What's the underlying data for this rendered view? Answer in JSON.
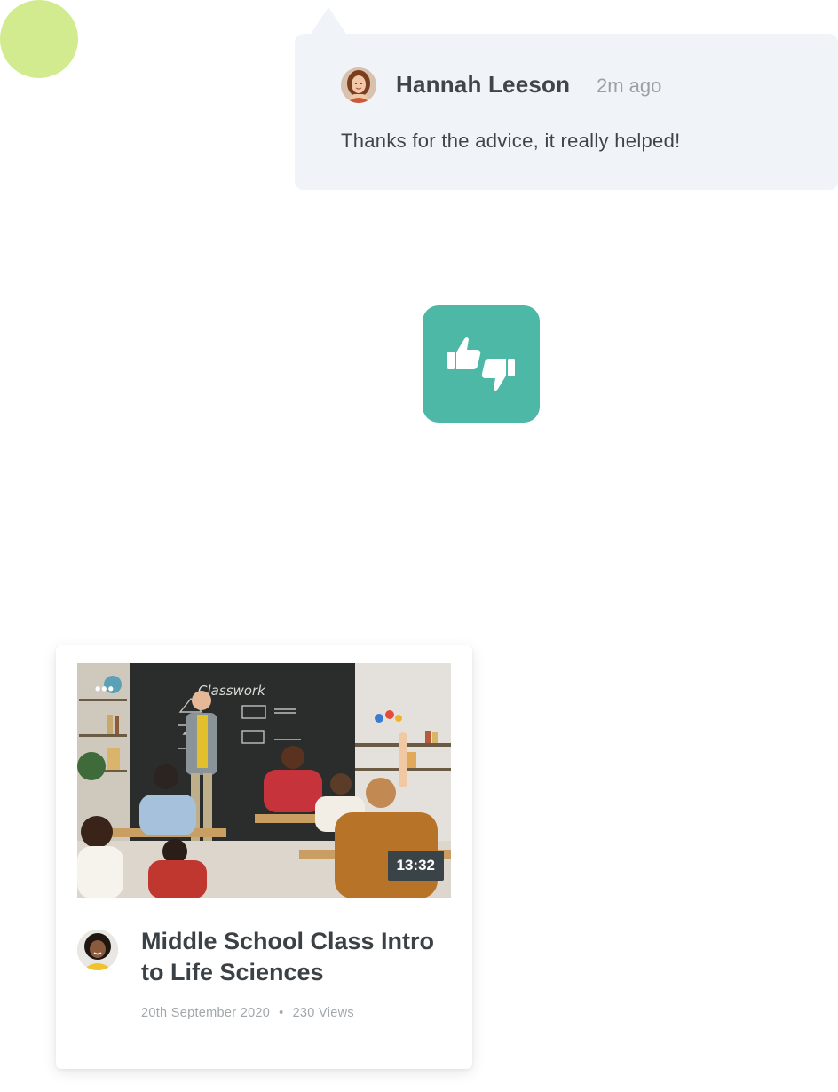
{
  "decor": {
    "blob_color": "#d2eb8f"
  },
  "comment": {
    "author": "Hannah Leeson",
    "time": "2m ago",
    "text": "Thanks for the advice, it really helped!",
    "avatar_icon": "user-avatar-hannah"
  },
  "feedback_tile": {
    "icon": "thumbs-up-down-icon",
    "color": "#4db8a6"
  },
  "video_card": {
    "duration": "13:32",
    "title": "Middle School Class Intro to Life Sciences",
    "date": "20th September 2020",
    "separator": "•",
    "views": "230 Views",
    "thumbnail_chalkboard_text": "Classwork",
    "more_icon": "more-dots-icon"
  }
}
